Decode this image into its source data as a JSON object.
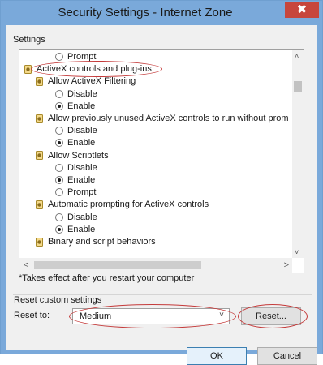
{
  "window": {
    "title": "Security Settings - Internet Zone",
    "close_glyph": "✖"
  },
  "settings": {
    "group_label": "Settings",
    "items": [
      {
        "type": "radio",
        "label": "Prompt",
        "checked": false
      },
      {
        "type": "category",
        "label": "ActiveX controls and plug-ins",
        "icon": "settings-gear-icon"
      },
      {
        "type": "setting",
        "label": "Allow ActiveX Filtering",
        "icon": "settings-gear-icon"
      },
      {
        "type": "radio",
        "label": "Disable",
        "checked": false
      },
      {
        "type": "radio",
        "label": "Enable",
        "checked": true
      },
      {
        "type": "setting",
        "label": "Allow previously unused ActiveX controls to run without prom",
        "icon": "settings-gear-icon"
      },
      {
        "type": "radio",
        "label": "Disable",
        "checked": false
      },
      {
        "type": "radio",
        "label": "Enable",
        "checked": true
      },
      {
        "type": "setting",
        "label": "Allow Scriptlets",
        "icon": "settings-gear-icon"
      },
      {
        "type": "radio",
        "label": "Disable",
        "checked": false
      },
      {
        "type": "radio",
        "label": "Enable",
        "checked": true
      },
      {
        "type": "radio",
        "label": "Prompt",
        "checked": false
      },
      {
        "type": "setting",
        "label": "Automatic prompting for ActiveX controls",
        "icon": "settings-gear-icon"
      },
      {
        "type": "radio",
        "label": "Disable",
        "checked": false
      },
      {
        "type": "radio",
        "label": "Enable",
        "checked": true
      },
      {
        "type": "setting",
        "label": "Binary and script behaviors",
        "icon": "settings-gear-icon"
      }
    ],
    "scroll_up": "˄",
    "scroll_down": "˅",
    "scroll_left": "<",
    "scroll_right": ">"
  },
  "note": "*Takes effect after you restart your computer",
  "reset": {
    "group_label": "Reset custom settings",
    "label": "Reset to:",
    "selected": "Medium",
    "chevron": "˅",
    "button_label": "Reset..."
  },
  "footer": {
    "ok_label": "OK",
    "cancel_label": "Cancel"
  },
  "annotations": {
    "color": "#c43a3a"
  }
}
